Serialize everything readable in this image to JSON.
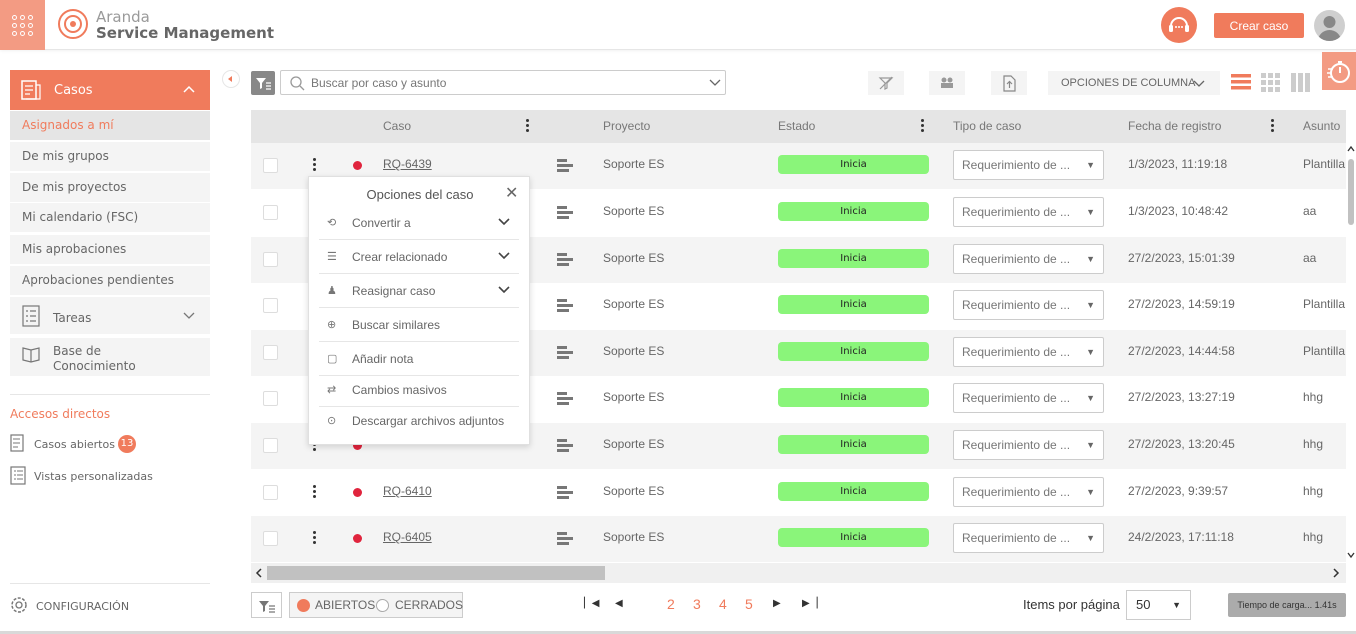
{
  "app": {
    "brand_line1": "Aranda",
    "brand_line2": "Service Management",
    "create_case": "Crear caso",
    "accent": "#f07b5c"
  },
  "sidebar": {
    "casos": "Casos",
    "items": [
      {
        "label": "Asignados a mí",
        "active": true
      },
      {
        "label": "De mis grupos"
      },
      {
        "label": "De mis proyectos"
      },
      {
        "label": "Mi calendario (FSC)"
      },
      {
        "label": "Mis aprobaciones"
      },
      {
        "label": "Aprobaciones pendientes"
      }
    ],
    "tareas": "Tareas",
    "base_line1": "Base de",
    "base_line2": "Conocimiento",
    "accesos_title": "Accesos directos",
    "casos_abiertos": "Casos abiertos",
    "casos_abiertos_count": "13",
    "vistas": "Vistas personalizadas",
    "configuracion": "CONFIGURACIÓN"
  },
  "toolbar": {
    "search_placeholder": "Buscar por caso y asunto",
    "column_options": "OPCIONES DE COLUMNA"
  },
  "table": {
    "headers": {
      "caso": "Caso",
      "proyecto": "Proyecto",
      "estado": "Estado",
      "tipo": "Tipo de caso",
      "fecha": "Fecha de registro",
      "asunto": "Asunto"
    },
    "rows": [
      {
        "caso": "RQ-6439",
        "proyecto": "Soporte ES",
        "estado": "Inicia",
        "tipo": "Requerimiento de ...",
        "fecha": "1/3/2023, 11:19:18",
        "asunto": "Plantilla"
      },
      {
        "caso": "",
        "proyecto": "Soporte ES",
        "estado": "Inicia",
        "tipo": "Requerimiento de ...",
        "fecha": "1/3/2023, 10:48:42",
        "asunto": "aa"
      },
      {
        "caso": "",
        "proyecto": "Soporte ES",
        "estado": "Inicia",
        "tipo": "Requerimiento de ...",
        "fecha": "27/2/2023, 15:01:39",
        "asunto": "aa"
      },
      {
        "caso": "",
        "proyecto": "Soporte ES",
        "estado": "Inicia",
        "tipo": "Requerimiento de ...",
        "fecha": "27/2/2023, 14:59:19",
        "asunto": "Plantilla"
      },
      {
        "caso": "",
        "proyecto": "Soporte ES",
        "estado": "Inicia",
        "tipo": "Requerimiento de ...",
        "fecha": "27/2/2023, 14:44:58",
        "asunto": "Plantilla"
      },
      {
        "caso": "",
        "proyecto": "Soporte ES",
        "estado": "Inicia",
        "tipo": "Requerimiento de ...",
        "fecha": "27/2/2023, 13:27:19",
        "asunto": "hhg"
      },
      {
        "caso": "",
        "proyecto": "Soporte ES",
        "estado": "Inicia",
        "tipo": "Requerimiento de ...",
        "fecha": "27/2/2023, 13:20:45",
        "asunto": "hhg"
      },
      {
        "caso": "RQ-6410",
        "proyecto": "Soporte ES",
        "estado": "Inicia",
        "tipo": "Requerimiento de ...",
        "fecha": "27/2/2023, 9:39:57",
        "asunto": "hhg"
      },
      {
        "caso": "RQ-6405",
        "proyecto": "Soporte ES",
        "estado": "Inicia",
        "tipo": "Requerimiento de ...",
        "fecha": "24/2/2023, 17:11:18",
        "asunto": "hhg"
      }
    ]
  },
  "context_menu": {
    "title": "Opciones del caso",
    "items": [
      {
        "label": "Convertir a",
        "expandable": true,
        "icon": "convert-icon"
      },
      {
        "label": "Crear relacionado",
        "expandable": true,
        "icon": "list-icon"
      },
      {
        "label": "Reasignar caso",
        "expandable": true,
        "icon": "reassign-icon"
      },
      {
        "label": "Buscar similares",
        "expandable": false,
        "icon": "search-plus-icon"
      },
      {
        "label": "Añadir nota",
        "expandable": false,
        "icon": "note-icon"
      },
      {
        "label": "Cambios masivos",
        "expandable": false,
        "icon": "swap-icon"
      },
      {
        "label": "Descargar archivos adjuntos",
        "expandable": false,
        "icon": "download-icon"
      }
    ]
  },
  "footer": {
    "abiertos": "ABIERTOS",
    "cerrados": "CERRADOS",
    "pages": [
      "2",
      "3",
      "4",
      "5"
    ],
    "items_label": "Items por página",
    "items_value": "50",
    "tiempo": "Tiempo de carga... 1.41s"
  }
}
